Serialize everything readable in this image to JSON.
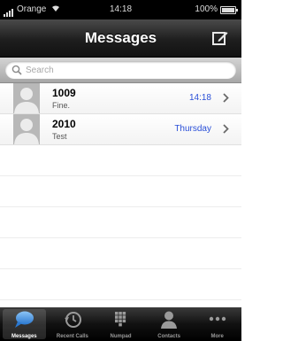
{
  "status_bar": {
    "carrier": "Orange",
    "time": "14:18",
    "battery": "100%"
  },
  "nav": {
    "title": "Messages",
    "compose_icon": "compose-icon"
  },
  "search": {
    "placeholder": "Search",
    "icon": "search-icon"
  },
  "messages": [
    {
      "name": "1009",
      "preview": "Fine.",
      "time": "14:18"
    },
    {
      "name": "2010",
      "preview": "Test",
      "time": "Thursday"
    }
  ],
  "tabs": [
    {
      "label": "Messages",
      "icon": "speech-bubble-icon",
      "active": true
    },
    {
      "label": "Recent Calls",
      "icon": "clock-icon",
      "active": false
    },
    {
      "label": "Numpad",
      "icon": "keypad-icon",
      "active": false
    },
    {
      "label": "Contacts",
      "icon": "person-icon",
      "active": false
    },
    {
      "label": "More",
      "icon": "more-icon",
      "active": false
    }
  ],
  "colors": {
    "time_blue": "#2a4fd8",
    "active_tab": "#3a8de0"
  }
}
